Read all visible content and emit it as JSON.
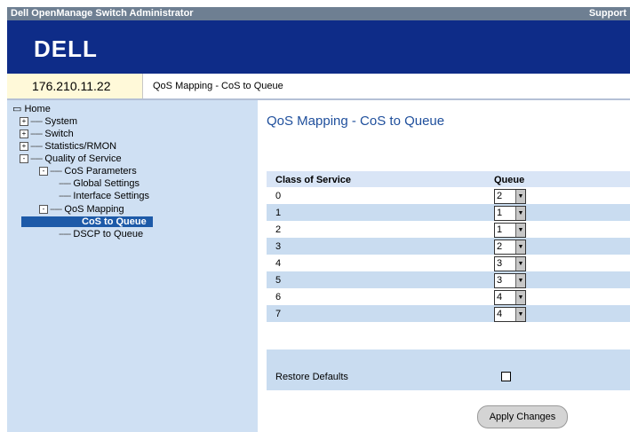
{
  "titlebar": {
    "app": "Dell OpenManage Switch Administrator",
    "support": "Support"
  },
  "brand": {
    "logo": "DELL"
  },
  "header": {
    "ip": "176.210.11.22",
    "breadcrumb": "QoS Mapping - CoS to Queue"
  },
  "sidebar": {
    "home": "Home",
    "items": [
      {
        "label": "System",
        "expander": "+"
      },
      {
        "label": "Switch",
        "expander": "+"
      },
      {
        "label": "Statistics/RMON",
        "expander": "+"
      },
      {
        "label": "Quality of Service",
        "expander": "-"
      },
      {
        "label": "CoS Parameters",
        "expander": "-"
      },
      {
        "label": "Global Settings"
      },
      {
        "label": "Interface Settings"
      },
      {
        "label": "QoS Mapping",
        "expander": "-"
      },
      {
        "label": "CoS to Queue",
        "selected": true
      },
      {
        "label": "DSCP to Queue"
      }
    ]
  },
  "main": {
    "title": "QoS Mapping - CoS to Queue",
    "table": {
      "headers": {
        "cos": "Class of Service",
        "queue": "Queue"
      },
      "rows": [
        {
          "cos": "0",
          "queue": "2"
        },
        {
          "cos": "1",
          "queue": "1"
        },
        {
          "cos": "2",
          "queue": "1"
        },
        {
          "cos": "3",
          "queue": "2"
        },
        {
          "cos": "4",
          "queue": "3"
        },
        {
          "cos": "5",
          "queue": "3"
        },
        {
          "cos": "6",
          "queue": "4"
        },
        {
          "cos": "7",
          "queue": "4"
        }
      ]
    },
    "restore_label": "Restore Defaults",
    "restore_checked": false,
    "apply_label": "Apply Changes"
  }
}
